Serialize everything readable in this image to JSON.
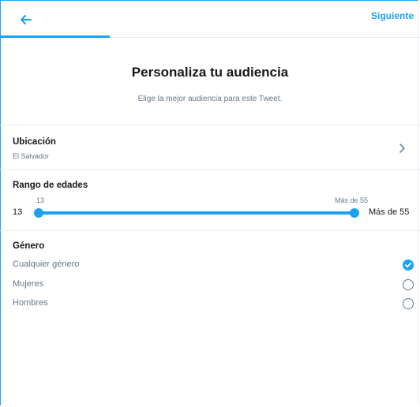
{
  "header": {
    "back_icon": "arrow-left-icon",
    "next_label": "Siguiente",
    "accent": "#1da1f2"
  },
  "main": {
    "title": "Personaliza tu audiencia",
    "subtitle": "Elige la mejor audiencia para este Tweet."
  },
  "location": {
    "label": "Ubicación",
    "value": "El Salvador",
    "chevron_icon": "chevron-right-icon"
  },
  "age_range": {
    "label": "Rango de edades",
    "min_top": "13",
    "max_top": "Más de 55",
    "min_side": "13",
    "max_side": "Más de 55",
    "selected_min_fraction": 0,
    "selected_max_fraction": 1
  },
  "gender": {
    "label": "Género",
    "options": [
      {
        "label": "Cualquier género",
        "selected": true
      },
      {
        "label": "Mujeres",
        "selected": false
      },
      {
        "label": "Hombres",
        "selected": false
      }
    ]
  }
}
